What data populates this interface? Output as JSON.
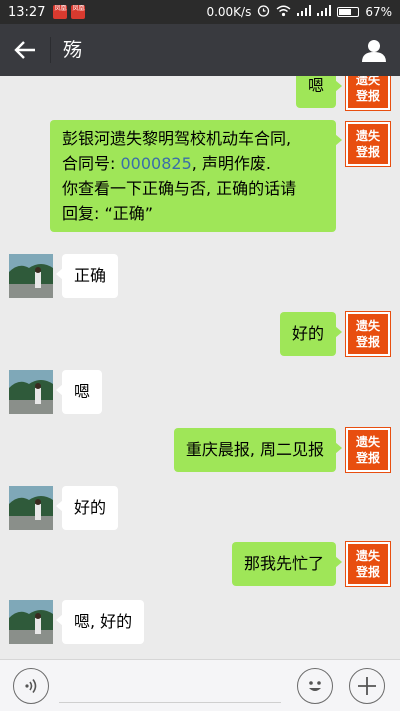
{
  "status_bar": {
    "time": "13:27",
    "app_badges": [
      "凤凰",
      "凤凰"
    ],
    "network_speed": "0.00K/s",
    "battery": "67%",
    "battery_level": 0.67
  },
  "header": {
    "title": "殇"
  },
  "self_avatar": {
    "line1": "遗失",
    "line2": "登报"
  },
  "messages": [
    {
      "from": "me",
      "text": "嗯"
    },
    {
      "from": "me",
      "line1": "彭银河遗失黎明驾校机动车合同,",
      "line2_prefix": "合同号: ",
      "contract_no": "0000825",
      "line2_suffix": ", 声明作废.",
      "line3": "你查看一下正确与否, 正确的话请",
      "line4": "回复: “正确”"
    },
    {
      "from": "other",
      "text": "正确"
    },
    {
      "from": "me",
      "text": "好的"
    },
    {
      "from": "other",
      "text": "嗯"
    },
    {
      "from": "me",
      "text": "重庆晨报, 周二见报"
    },
    {
      "from": "other",
      "text": "好的"
    },
    {
      "from": "me",
      "text": "那我先忙了"
    },
    {
      "from": "other",
      "text": "嗯, 好的"
    }
  ],
  "input_bar": {
    "voice_icon": "voice-icon",
    "emoji_icon": "emoji-icon",
    "plus_icon": "plus-icon"
  }
}
